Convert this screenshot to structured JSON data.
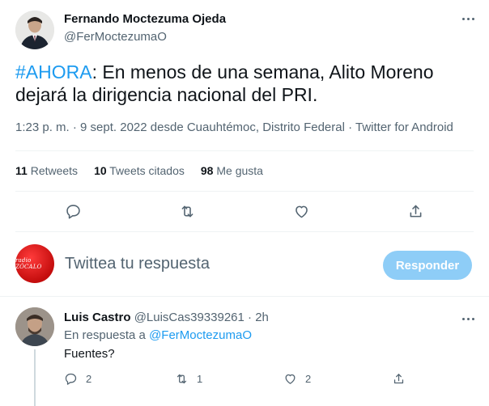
{
  "tweet": {
    "author_name": "Fernando Moctezuma Ojeda",
    "author_handle": "@FerMoctezumaO",
    "hashtag": "#AHORA",
    "text_line1_rest": ": En menos de una semana, Alito Moreno",
    "text_line2": "dejará la dirigencia nacional del PRI.",
    "time": "1:23 p. m.",
    "separator": " · ",
    "date": "9 sept. 2022",
    "location_prefix": " desde ",
    "location": "Cuauhtémoc, Distrito Federal",
    "source": "Twitter for Android",
    "stats": {
      "retweets_count": "11",
      "retweets_label": " Retweets",
      "quotes_count": "10",
      "quotes_label": " Tweets citados",
      "likes_count": "98",
      "likes_label": " Me gusta"
    },
    "actions": [
      "reply-icon",
      "retweet-icon",
      "like-icon",
      "share-icon"
    ]
  },
  "reply_box": {
    "placeholder": "Twittea tu respuesta",
    "button_label": "Responder",
    "avatar_text": "radio ZÓCALO"
  },
  "reply": {
    "name": "Luis Castro",
    "handle": "@LuisCas39339261",
    "time_sep": " · ",
    "time": "2h",
    "reply_to_prefix": "En respuesta a ",
    "reply_to_mention": "@FerMoctezumaO",
    "body": "Fuentes?",
    "reply_count": "2",
    "retweet_count": "1",
    "like_count": "2"
  },
  "colors": {
    "accent": "#1d9bf0",
    "muted": "#536471",
    "reply_button": "#8ecdf7",
    "radio_avatar": "#d81b1b"
  }
}
